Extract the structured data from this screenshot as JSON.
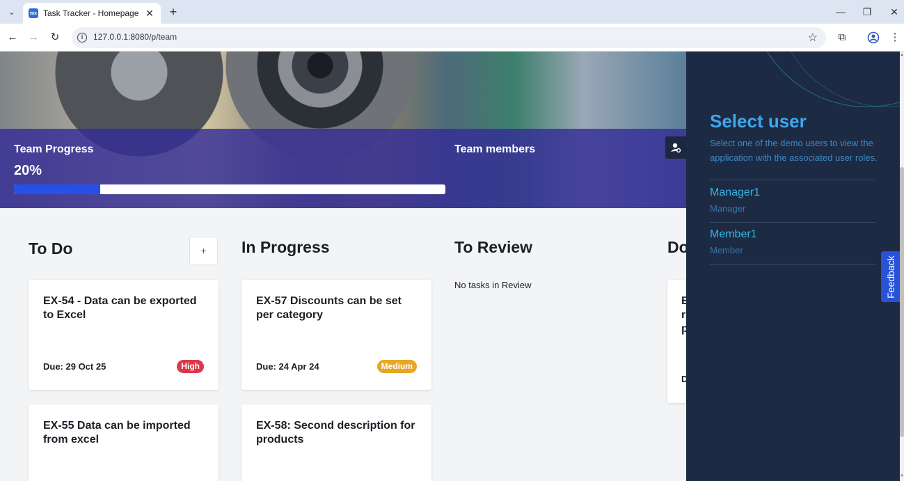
{
  "browser": {
    "tab_title": "Task Tracker - Homepage",
    "favicon_text": "mx",
    "url": "127.0.0.1:8080/p/team",
    "icons": [
      "tab-dropdown-icon",
      "close-icon",
      "new-tab-icon",
      "minimize-icon",
      "restore-icon",
      "window-close-icon",
      "back-icon",
      "forward-icon",
      "reload-icon",
      "site-info-icon",
      "bookmark-star-icon",
      "extensions-icon",
      "profile-icon",
      "menu-icon"
    ]
  },
  "team": {
    "progress_title": "Team Progress",
    "progress_label": "20%",
    "progress_value": 0.2,
    "progress_color": "#2750e8",
    "members_title": "Team members"
  },
  "board": {
    "add_label": "+",
    "columns": [
      {
        "title": "To Do"
      },
      {
        "title": "In Progress"
      },
      {
        "title": "To Review",
        "empty_text": "No tasks in Review"
      },
      {
        "title": "Do"
      }
    ],
    "todo_cards": [
      {
        "title": "EX-54 - Data can be exported to Excel",
        "due": "Due: 29 Oct 25",
        "priority": "High",
        "priority_color": "#d93a4b"
      },
      {
        "title": "EX-55 Data can be imported from excel"
      }
    ],
    "inprogress_cards": [
      {
        "title": "EX-57 Discounts can be set per category",
        "due": "Due: 24 Apr 24",
        "priority": "Medium",
        "priority_color": "#e7a623"
      },
      {
        "title": "EX-58: Second description for products"
      }
    ],
    "done_card": {
      "title_lines": [
        "E",
        "r",
        "p"
      ],
      "due": "D"
    }
  },
  "panel": {
    "title": "Select user",
    "description": "Select one of the demo users to view the application with the associated user roles.",
    "users": [
      {
        "name": "Manager1",
        "role": "Manager"
      },
      {
        "name": "Member1",
        "role": "Member"
      }
    ],
    "feedback_label": "Feedback"
  }
}
